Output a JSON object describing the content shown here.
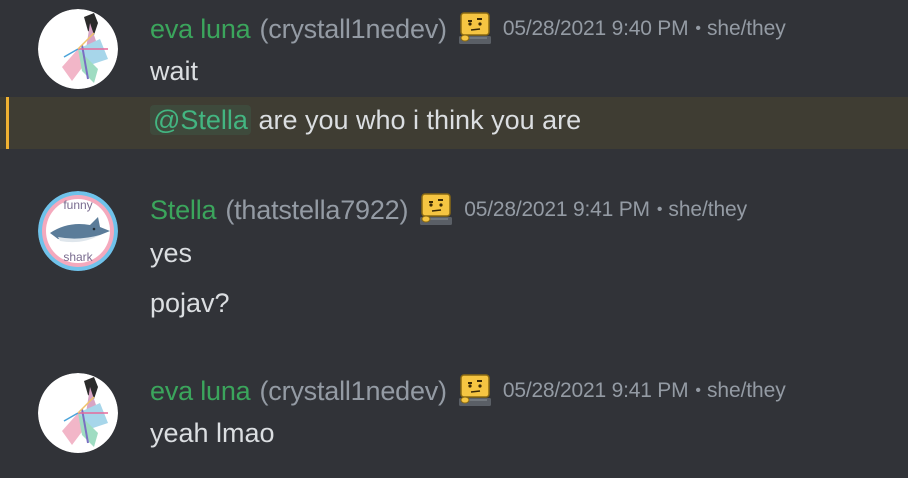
{
  "colors": {
    "background": "#313338",
    "name_green": "#3ba55c",
    "muted": "#949ba4",
    "text": "#dbdee1",
    "highlight_bg": "#3f3d33",
    "highlight_bar": "#f0b232"
  },
  "messages": [
    {
      "display_name": "eva luna",
      "username": "(crystall1nedev)",
      "badge": "thinking-computer-emoji",
      "timestamp": "05/28/2021 9:40 PM",
      "separator": "•",
      "pronouns": "she/they",
      "lines": [
        "wait"
      ],
      "mention_line": {
        "mention": "@Stella",
        "text": " are you who i think you are"
      }
    },
    {
      "display_name": "Stella",
      "username": "(thatstella7922)",
      "badge": "thinking-computer-emoji",
      "timestamp": "05/28/2021 9:41 PM",
      "separator": "•",
      "pronouns": "she/they",
      "avatar_text_top": "funny",
      "avatar_text_bottom": "shark",
      "lines": [
        "yes",
        "pojav?"
      ]
    },
    {
      "display_name": "eva luna",
      "username": "(crystall1nedev)",
      "badge": "thinking-computer-emoji",
      "timestamp": "05/28/2021 9:41 PM",
      "separator": "•",
      "pronouns": "she/they",
      "lines": [
        "yeah lmao"
      ]
    }
  ]
}
